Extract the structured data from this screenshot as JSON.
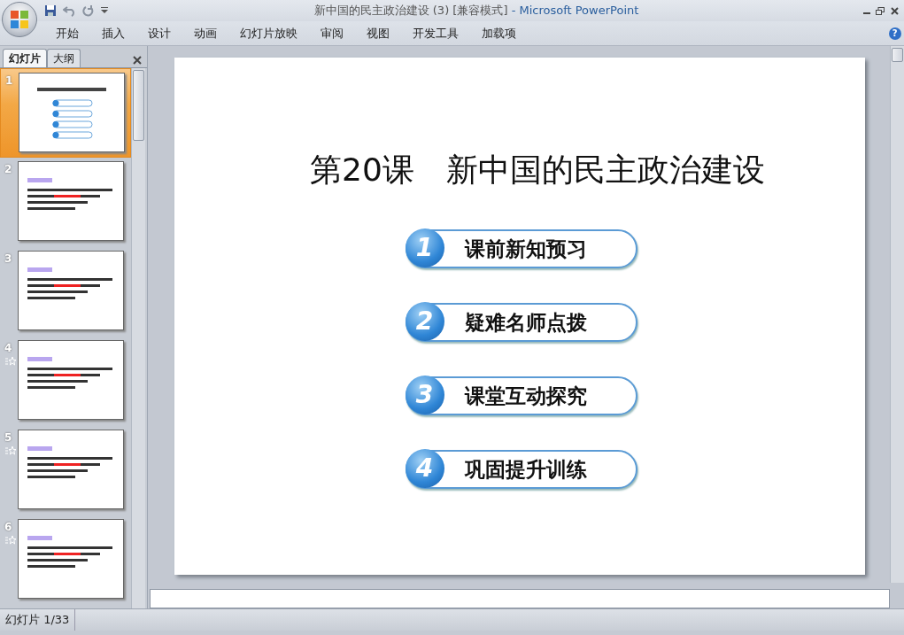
{
  "window": {
    "document_title": "新中国的民主政治建设 (3) [兼容模式]",
    "app_title": "- Microsoft PowerPoint"
  },
  "ribbon_tabs": [
    {
      "label": "开始"
    },
    {
      "label": "插入"
    },
    {
      "label": "设计"
    },
    {
      "label": "动画"
    },
    {
      "label": "幻灯片放映"
    },
    {
      "label": "审阅"
    },
    {
      "label": "视图"
    },
    {
      "label": "开发工具"
    },
    {
      "label": "加载项"
    }
  ],
  "help_button": "?",
  "pane_tabs": [
    {
      "label": "幻灯片",
      "selected": true
    },
    {
      "label": "大纲",
      "selected": false
    }
  ],
  "slides": [
    {
      "number": "1",
      "selected": true,
      "animated": false,
      "kind": "title"
    },
    {
      "number": "2",
      "selected": false,
      "animated": false,
      "kind": "text"
    },
    {
      "number": "3",
      "selected": false,
      "animated": false,
      "kind": "text"
    },
    {
      "number": "4",
      "selected": false,
      "animated": true,
      "kind": "text"
    },
    {
      "number": "5",
      "selected": false,
      "animated": true,
      "kind": "text"
    },
    {
      "number": "6",
      "selected": false,
      "animated": true,
      "kind": "text"
    }
  ],
  "slide": {
    "title": "第20课　新中国的民主政治建设",
    "items": [
      {
        "number": "1",
        "label": "课前新知预习"
      },
      {
        "number": "2",
        "label": "疑难名师点拨"
      },
      {
        "number": "3",
        "label": "课堂互动探究"
      },
      {
        "number": "4",
        "label": "巩固提升训练"
      }
    ]
  },
  "status_bar": {
    "slide_count": "幻灯片 1/33"
  }
}
